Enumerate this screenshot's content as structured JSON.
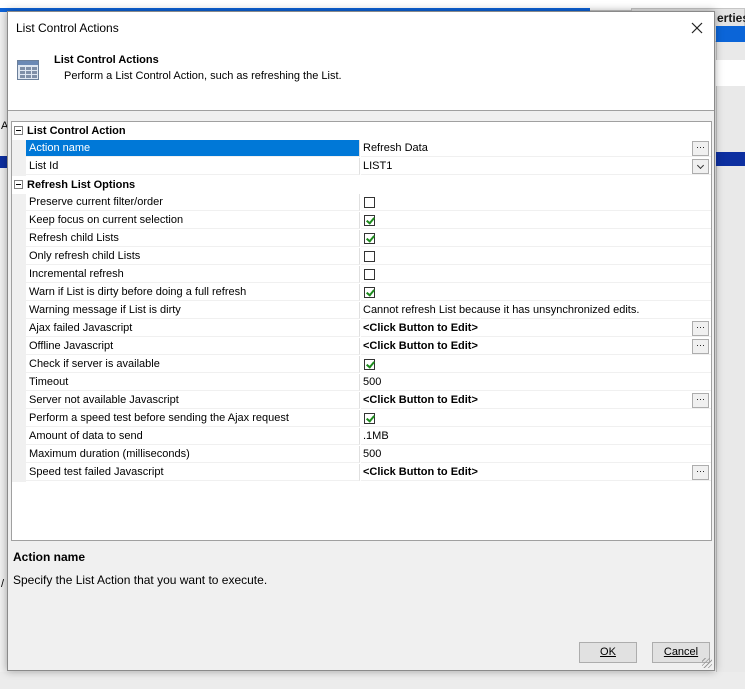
{
  "background": {
    "right_tab_text": "erties",
    "left_char_1": "A",
    "left_char_2": "/"
  },
  "dialog": {
    "title": "List Control Actions",
    "header_title": "List Control Actions",
    "header_subtitle": "Perform a List Control Action, such as refreshing the List.",
    "description_title": "Action name",
    "description_text": "Specify the List Action that you want to execute.",
    "ok_label": "OK",
    "cancel_label": "Cancel"
  },
  "grid": {
    "categories": [
      {
        "label": "List Control Action",
        "rows": [
          {
            "name": "Action name",
            "type": "text",
            "value": "Refresh Data",
            "button": "ellipsis",
            "selected": true
          },
          {
            "name": "List Id",
            "type": "text",
            "value": "LIST1",
            "button": "dropdown"
          }
        ]
      },
      {
        "label": "Refresh List Options",
        "rows": [
          {
            "name": "Preserve current filter/order",
            "type": "check",
            "checked": false
          },
          {
            "name": "Keep focus on current selection",
            "type": "check",
            "checked": true
          },
          {
            "name": "Refresh child Lists",
            "type": "check",
            "checked": true
          },
          {
            "name": "Only refresh child Lists",
            "type": "check",
            "checked": false
          },
          {
            "name": "Incremental refresh",
            "type": "check",
            "checked": false
          },
          {
            "name": "Warn if List is dirty before doing a full refresh",
            "type": "check",
            "checked": true
          },
          {
            "name": "Warning message if List is dirty",
            "type": "text",
            "value": "Cannot refresh List because it has unsynchronized edits."
          },
          {
            "name": "Ajax failed Javascript",
            "type": "bold",
            "value": "<Click Button to Edit>",
            "button": "ellipsis"
          },
          {
            "name": "Offline Javascript",
            "type": "bold",
            "value": "<Click Button to Edit>",
            "button": "ellipsis"
          },
          {
            "name": "Check if server is available",
            "type": "check",
            "checked": true
          },
          {
            "name": "Timeout",
            "type": "text",
            "value": "500"
          },
          {
            "name": "Server not available Javascript",
            "type": "bold",
            "value": "<Click Button to Edit>",
            "button": "ellipsis"
          },
          {
            "name": "Perform a speed test before sending the Ajax request",
            "type": "check",
            "checked": true
          },
          {
            "name": "Amount of data to send",
            "type": "text",
            "value": ".1MB"
          },
          {
            "name": "Maximum duration (milliseconds)",
            "type": "text",
            "value": "500"
          },
          {
            "name": "Speed test failed Javascript",
            "type": "bold",
            "value": "<Click Button to Edit>",
            "button": "ellipsis"
          }
        ]
      }
    ]
  }
}
